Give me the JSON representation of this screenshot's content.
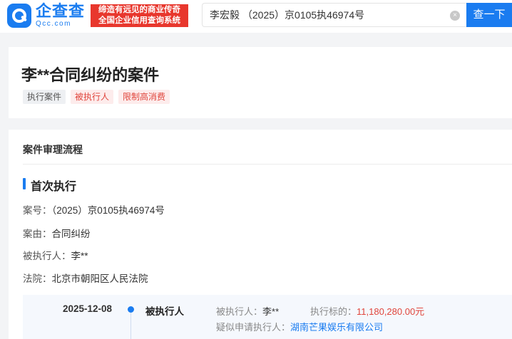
{
  "header": {
    "logo_name": "企查查",
    "logo_domain": "Qcc.com",
    "slogan_line1": "缔造有远见的商业传奇",
    "slogan_line2": "全国企业信用查询系统",
    "search_value": "李宏毅 （2025）京0105执46974号",
    "clear_glyph": "×",
    "search_button": "查一下"
  },
  "case": {
    "title": "李**合同纠纷的案件",
    "tags": [
      "执行案件",
      "被执行人",
      "限制高消费"
    ]
  },
  "process": {
    "section_title": "案件审理流程",
    "stage_title": "首次执行",
    "fields": [
      {
        "label": "案号：",
        "value": "（2025）京0105执46974号"
      },
      {
        "label": "案由：",
        "value": "合同纠纷"
      },
      {
        "label": "被执行人：",
        "value": "李**"
      },
      {
        "label": "法院：",
        "value": "北京市朝阳区人民法院"
      }
    ],
    "timeline": {
      "date": "2025-12-08",
      "role": "被执行人",
      "respondent_label": "被执行人：",
      "respondent_value": "李**",
      "amount_label": "执行标的：",
      "amount_value": "11,180,280.00元",
      "applicant_label": "疑似申请执行人：",
      "applicant_value": "湖南芒果娱乐有限公司"
    }
  },
  "colors": {
    "brand_blue": "#1a7cf0",
    "slogan_red": "#e8372d",
    "alert_red": "#e0453c"
  }
}
